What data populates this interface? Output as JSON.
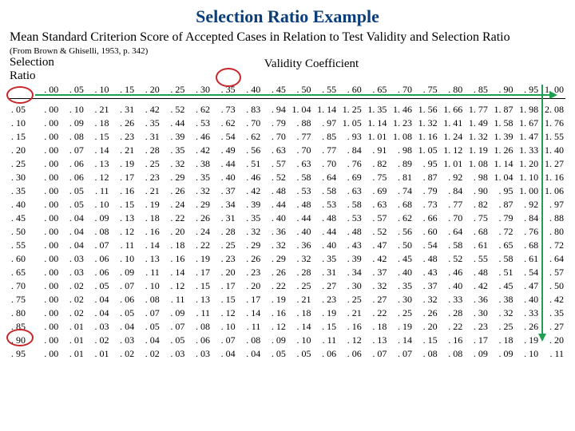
{
  "title": "Selection Ratio Example",
  "subtitle": "Mean Standard Criterion Score of Accepted Cases in Relation to Test Validity and Selection Ratio",
  "source": "(From Brown & Ghiselli, 1953, p. 342)",
  "selection_ratio_label": "Selection\nRatio",
  "validity_label": "Validity Coefficient",
  "chart_data": {
    "type": "table",
    "title": "Mean Standard Criterion Score of Accepted Cases in Relation to Test Validity and Selection Ratio",
    "xlabel": "Validity Coefficient",
    "ylabel": "Selection Ratio",
    "col_headers": [
      ". 00",
      ". 05",
      ". 10",
      ". 15",
      ". 20",
      ". 25",
      ". 30",
      ". 35",
      ". 40",
      ". 45",
      ". 50",
      ". 55",
      ". 60",
      ". 65",
      ". 70",
      ". 75",
      ". 80",
      ". 85",
      ". 90",
      ". 95",
      "1. 00"
    ],
    "row_headers": [
      ". 05",
      ". 10",
      ". 15",
      ". 20",
      ". 25",
      ". 30",
      ". 35",
      ". 40",
      ". 45",
      ". 50",
      ". 55",
      ". 60",
      ". 65",
      ". 70",
      ". 75",
      ". 80",
      ". 85",
      ". 90",
      ". 95"
    ],
    "rows": [
      [
        ". 00",
        ". 10",
        ". 21",
        ". 31",
        ". 42",
        ". 52",
        ". 62",
        ". 73",
        ". 83",
        ". 94",
        "1. 04",
        "1. 14",
        "1. 25",
        "1. 35",
        "1. 46",
        "1. 56",
        "1. 66",
        "1. 77",
        "1. 87",
        "1. 98",
        "2. 08"
      ],
      [
        ". 00",
        ". 09",
        ". 18",
        ". 26",
        ". 35",
        ". 44",
        ". 53",
        ". 62",
        ". 70",
        ". 79",
        ". 88",
        ". 97",
        "1. 05",
        "1. 14",
        "1. 23",
        "1. 32",
        "1. 41",
        "1. 49",
        "1. 58",
        "1. 67",
        "1. 76"
      ],
      [
        ". 00",
        ". 08",
        ". 15",
        ". 23",
        ". 31",
        ". 39",
        ". 46",
        ". 54",
        ". 62",
        ". 70",
        ". 77",
        ". 85",
        ". 93",
        "1. 01",
        "1. 08",
        "1. 16",
        "1. 24",
        "1. 32",
        "1. 39",
        "1. 47",
        "1. 55"
      ],
      [
        ". 00",
        ". 07",
        ". 14",
        ". 21",
        ". 28",
        ". 35",
        ". 42",
        ". 49",
        ". 56",
        ". 63",
        ". 70",
        ". 77",
        ". 84",
        ". 91",
        ". 98",
        "1. 05",
        "1. 12",
        "1. 19",
        "1. 26",
        "1. 33",
        "1. 40"
      ],
      [
        ". 00",
        ". 06",
        ". 13",
        ". 19",
        ". 25",
        ". 32",
        ". 38",
        ". 44",
        ". 51",
        ". 57",
        ". 63",
        ". 70",
        ". 76",
        ". 82",
        ". 89",
        ". 95",
        "1. 01",
        "1. 08",
        "1. 14",
        "1. 20",
        "1. 27"
      ],
      [
        ". 00",
        ". 06",
        ". 12",
        ". 17",
        ". 23",
        ". 29",
        ". 35",
        ". 40",
        ". 46",
        ". 52",
        ". 58",
        ". 64",
        ". 69",
        ". 75",
        ". 81",
        ". 87",
        ". 92",
        ". 98",
        "1. 04",
        "1. 10",
        "1. 16"
      ],
      [
        ". 00",
        ". 05",
        ". 11",
        ". 16",
        ". 21",
        ". 26",
        ". 32",
        ". 37",
        ". 42",
        ". 48",
        ". 53",
        ". 58",
        ". 63",
        ". 69",
        ". 74",
        ". 79",
        ". 84",
        ". 90",
        ". 95",
        "1. 00",
        "1. 06"
      ],
      [
        ". 00",
        ". 05",
        ". 10",
        ". 15",
        ". 19",
        ". 24",
        ". 29",
        ". 34",
        ". 39",
        ". 44",
        ". 48",
        ". 53",
        ". 58",
        ". 63",
        ". 68",
        ". 73",
        ". 77",
        ". 82",
        ". 87",
        ". 92",
        ". 97"
      ],
      [
        ". 00",
        ". 04",
        ". 09",
        ". 13",
        ". 18",
        ". 22",
        ". 26",
        ". 31",
        ". 35",
        ". 40",
        ". 44",
        ". 48",
        ". 53",
        ". 57",
        ". 62",
        ". 66",
        ". 70",
        ". 75",
        ". 79",
        ". 84",
        ". 88"
      ],
      [
        ". 00",
        ". 04",
        ". 08",
        ". 12",
        ". 16",
        ". 20",
        ". 24",
        ". 28",
        ". 32",
        ". 36",
        ". 40",
        ". 44",
        ". 48",
        ". 52",
        ". 56",
        ". 60",
        ". 64",
        ". 68",
        ". 72",
        ". 76",
        ". 80"
      ],
      [
        ". 00",
        ". 04",
        ". 07",
        ". 11",
        ". 14",
        ". 18",
        ". 22",
        ". 25",
        ". 29",
        ". 32",
        ". 36",
        ". 40",
        ". 43",
        ". 47",
        ". 50",
        ". 54",
        ". 58",
        ". 61",
        ". 65",
        ". 68",
        ". 72"
      ],
      [
        ". 00",
        ". 03",
        ". 06",
        ". 10",
        ". 13",
        ". 16",
        ". 19",
        ". 23",
        ". 26",
        ". 29",
        ". 32",
        ". 35",
        ". 39",
        ". 42",
        ". 45",
        ". 48",
        ". 52",
        ". 55",
        ". 58",
        ". 61",
        ". 64"
      ],
      [
        ". 00",
        ". 03",
        ". 06",
        ". 09",
        ". 11",
        ". 14",
        ". 17",
        ". 20",
        ". 23",
        ". 26",
        ". 28",
        ". 31",
        ". 34",
        ". 37",
        ". 40",
        ". 43",
        ". 46",
        ". 48",
        ". 51",
        ". 54",
        ". 57"
      ],
      [
        ". 00",
        ". 02",
        ". 05",
        ". 07",
        ". 10",
        ". 12",
        ". 15",
        ". 17",
        ". 20",
        ". 22",
        ". 25",
        ". 27",
        ". 30",
        ". 32",
        ". 35",
        ". 37",
        ". 40",
        ". 42",
        ". 45",
        ". 47",
        ". 50"
      ],
      [
        ". 00",
        ". 02",
        ". 04",
        ". 06",
        ". 08",
        ". 11",
        ". 13",
        ". 15",
        ". 17",
        ". 19",
        ". 21",
        ". 23",
        ". 25",
        ". 27",
        ". 30",
        ". 32",
        ". 33",
        ". 36",
        ". 38",
        ". 40",
        ". 42"
      ],
      [
        ". 00",
        ". 02",
        ". 04",
        ". 05",
        ". 07",
        ". 09",
        ". 11",
        ". 12",
        ". 14",
        ". 16",
        ". 18",
        ". 19",
        ". 21",
        ". 22",
        ". 25",
        ". 26",
        ". 28",
        ". 30",
        ". 32",
        ". 33",
        ". 35"
      ],
      [
        ". 00",
        ". 01",
        ". 03",
        ". 04",
        ". 05",
        ". 07",
        ". 08",
        ". 10",
        ". 11",
        ". 12",
        ". 14",
        ". 15",
        ". 16",
        ". 18",
        ". 19",
        ". 20",
        ". 22",
        ". 23",
        ". 25",
        ". 26",
        ". 27"
      ],
      [
        ". 00",
        ". 01",
        ". 02",
        ". 03",
        ". 04",
        ". 05",
        ". 06",
        ". 07",
        ". 08",
        ". 09",
        ". 10",
        ". 11",
        ". 12",
        ". 13",
        ". 14",
        ". 15",
        ". 16",
        ". 17",
        ". 18",
        ". 19",
        ". 20"
      ],
      [
        ". 00",
        ". 01",
        ". 01",
        ". 02",
        ". 02",
        ". 03",
        ". 03",
        ". 04",
        ". 04",
        ". 05",
        ". 05",
        ". 06",
        ". 06",
        ". 07",
        ". 07",
        ". 08",
        ". 08",
        ". 09",
        ". 09",
        ". 10",
        ". 11"
      ]
    ],
    "highlight_col": ". 35",
    "highlight_rows": [
      ". 05",
      ". 95"
    ]
  }
}
